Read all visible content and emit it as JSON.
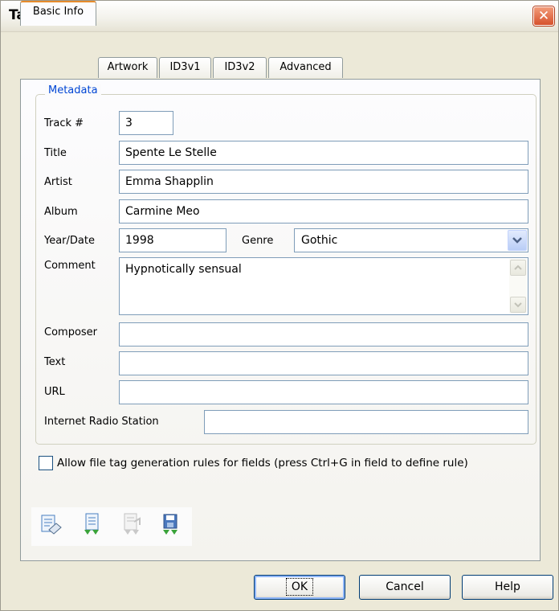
{
  "window": {
    "title": "Tag",
    "close_glyph": "✕"
  },
  "tabs": [
    {
      "label": "Basic Info",
      "active": true
    },
    {
      "label": "Artwork"
    },
    {
      "label": "ID3v1"
    },
    {
      "label": "ID3v2"
    },
    {
      "label": "Advanced"
    }
  ],
  "metadata": {
    "group_label": "Metadata",
    "track": {
      "label": "Track #",
      "value": "3"
    },
    "title": {
      "label": "Title",
      "value": "Spente Le Stelle"
    },
    "artist": {
      "label": "Artist",
      "value": "Emma Shapplin"
    },
    "album": {
      "label": "Album",
      "value": "Carmine Meo"
    },
    "year": {
      "label": "Year/Date",
      "value": "1998"
    },
    "genre": {
      "label": "Genre",
      "value": "Gothic"
    },
    "comment": {
      "label": "Comment",
      "value": "Hypnotically sensual"
    },
    "composer": {
      "label": "Composer",
      "value": ""
    },
    "text": {
      "label": "Text",
      "value": ""
    },
    "url": {
      "label": "URL",
      "value": ""
    },
    "radio": {
      "label": "Internet Radio Station",
      "value": ""
    }
  },
  "rules_checkbox": {
    "label": "Allow file tag generation rules for fields (press Ctrl+G in field to define rule)",
    "checked": false
  },
  "toolbar_icons": [
    "edit-eraser-icon",
    "import-down-icon",
    "transfer-disabled-icon",
    "save-down-icon"
  ],
  "buttons": {
    "ok": "OK",
    "cancel": "Cancel",
    "help": "Help"
  },
  "colors": {
    "accent_tab": "#e68b2c",
    "group_label": "#0046d5",
    "button_border": "#003c74"
  }
}
